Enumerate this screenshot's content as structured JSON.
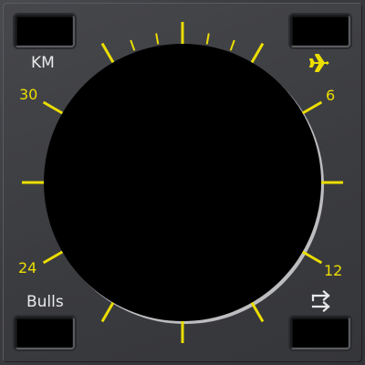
{
  "corner_labels": {
    "top_left": "KM",
    "bottom_left": "Bulls"
  },
  "dial": {
    "numbers": {
      "n30": "30",
      "n6": "6",
      "n24": "24",
      "n12": "12"
    },
    "tick_color": "#ecde00",
    "display_color": "#000000"
  },
  "icons": {
    "top_right": "airplane-icon",
    "bottom_right": "swap-arrows-icon"
  }
}
